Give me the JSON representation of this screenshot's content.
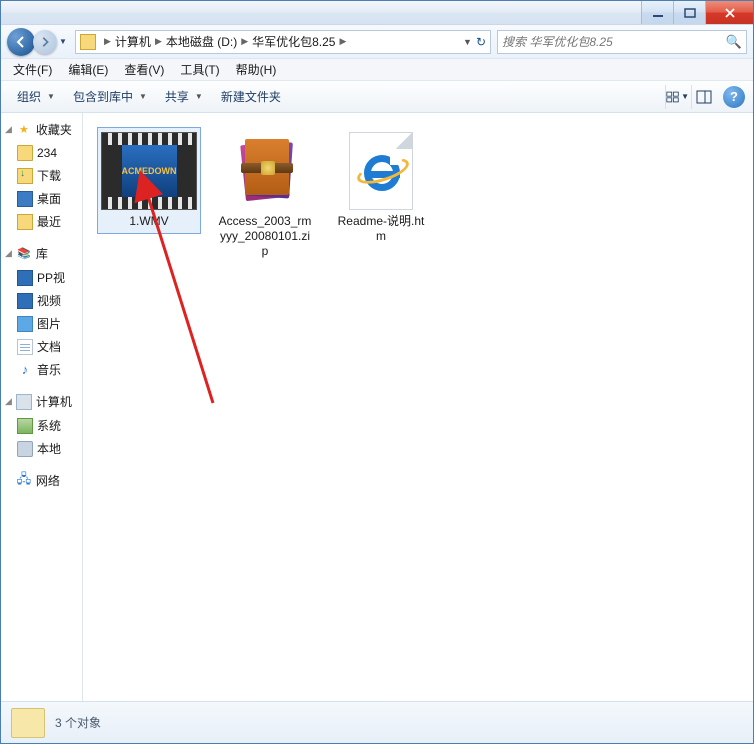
{
  "titlebar": {},
  "address": {
    "crumbs": [
      "计算机",
      "本地磁盘 (D:)",
      "华军优化包8.25"
    ]
  },
  "search": {
    "placeholder": "搜索 华军优化包8.25"
  },
  "menubar": {
    "items": [
      "文件(F)",
      "编辑(E)",
      "查看(V)",
      "工具(T)",
      "帮助(H)"
    ]
  },
  "toolbar": {
    "organize": "组织",
    "include": "包含到库中",
    "share": "共享",
    "newfolder": "新建文件夹"
  },
  "sidebar": {
    "favorites": {
      "label": "收藏夹",
      "items": [
        "234",
        "下载",
        "桌面",
        "最近"
      ]
    },
    "libraries": {
      "label": "库",
      "items": [
        "PP视",
        "视频",
        "图片",
        "文档",
        "音乐"
      ]
    },
    "computer": {
      "label": "计算机",
      "items": [
        "系统",
        "本地"
      ]
    },
    "network": {
      "label": "网络"
    }
  },
  "files": {
    "items": [
      {
        "name": "1.WMV",
        "type": "video",
        "selected": true
      },
      {
        "name": "Access_2003_rmyyy_20080101.zip",
        "type": "zip",
        "selected": false
      },
      {
        "name": "Readme-说明.htm",
        "type": "htm",
        "selected": false
      }
    ]
  },
  "statusbar": {
    "text": "3 个对象"
  }
}
